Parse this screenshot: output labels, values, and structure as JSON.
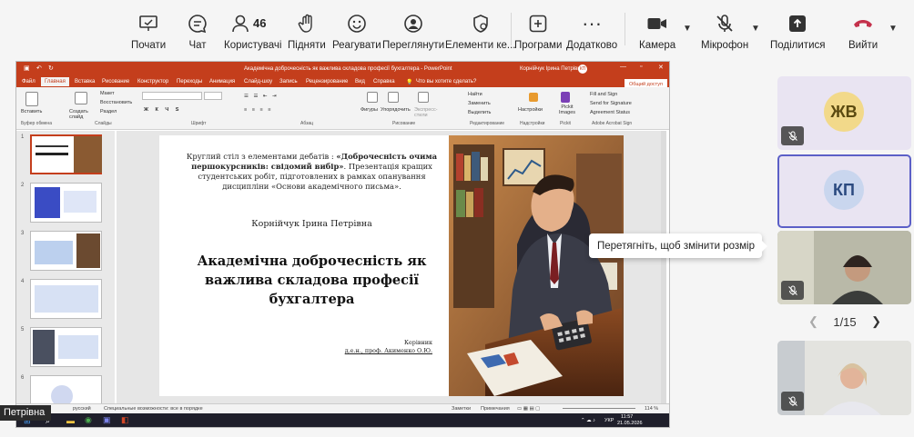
{
  "teams_toolbar": {
    "chat_label": "Чат",
    "people_label": "Користувачі",
    "people_count": "46",
    "raise_label": "Підняти",
    "react_label": "Реагувати",
    "view_label": "Переглянути",
    "elements_label": "Елементи ке...",
    "apps_label": "Програми",
    "more_label": "Додатково",
    "camera_label": "Камера",
    "mic_label": "Мікрофон",
    "share_label": "Поділитися",
    "leave_label": "Вийти",
    "start_label": "Почати"
  },
  "powerpoint": {
    "window_title": "Академічна доброчесність як важлива складова професії бухгалтера  -  PowerPoint",
    "user_name": "Корнійчук Ірина Петрівна",
    "user_initials": "КП",
    "tabs": [
      "Файл",
      "Главная",
      "Вставка",
      "Рисование",
      "Конструктор",
      "Переходы",
      "Анимация",
      "Слайд-шоу",
      "Запись",
      "Рецензирование",
      "Вид",
      "Справка"
    ],
    "tell_me": "Что вы хотите сделать?",
    "share_button": "Общий доступ",
    "ribbon": {
      "paste": "Вставить",
      "clipboard_group": "Буфер обмена",
      "new_slide": "Создать слайд",
      "layout": "Макет",
      "reset": "Восстановить",
      "section": "Раздел",
      "slides_group": "Слайды",
      "font_group": "Шрифт",
      "paragraph_group": "Абзац",
      "shapes": "Фигуры",
      "arrange": "Упорядочить",
      "quick_styles": "Экспресс-стили",
      "drawing_group": "Рисование",
      "find": "Найти",
      "replace": "Заменить",
      "select": "Выделить",
      "editing_group": "Редактирование",
      "settings": "Настройки",
      "pickit_images": "Pickit Images",
      "pickit_group": "Pickit",
      "fill_sign": "Fill and Sign",
      "send_signature": "Send for Signature",
      "agreement_status": "Agreement Status",
      "adobe_group": "Adobe Acrobat Sign",
      "addins_group": "Надстройки"
    },
    "slide_numbers": [
      "1",
      "2",
      "3",
      "4",
      "5",
      "6"
    ],
    "slide": {
      "lead_normal": "Круглий стіл з елементами дебатів : ",
      "lead_bold": "«Доброчесність очима першокурсників: свідомий вибір»",
      "lead_rest": ". Презентація кращих студентських робіт, підготовлених в рамках опанування дисципліни «Основи академічного письма».",
      "author": "Корнійчук Ірина Петрівна",
      "title": "Академічна доброчесність як важлива складова професії бухгалтера",
      "supervisor_label": "Керівник",
      "supervisor": "д.е.н., проф. Акименко О.Ю."
    },
    "status": {
      "language": "русский",
      "accessibility": "Специальные возможности: все в порядке",
      "notes": "Заметки",
      "comments": "Примечания",
      "zoom": "114 %"
    },
    "taskbar": {
      "lang": "УКР",
      "time": "11:57",
      "date": "21.05.2026"
    }
  },
  "presenter_name": "Петрівна",
  "participants": [
    {
      "initials": "ЖВ",
      "color": "#f2d98a",
      "text_color": "#5b4a10"
    },
    {
      "initials": "КП",
      "color": "#c9d6ee",
      "text_color": "#2b4a80"
    }
  ],
  "tooltip": "Перетягніть, щоб змінити розмір",
  "pager": "1/15",
  "colors": {
    "accent": "#c43e1c",
    "teams_purple": "#5b5fc7",
    "leave_red": "#c4314b"
  }
}
